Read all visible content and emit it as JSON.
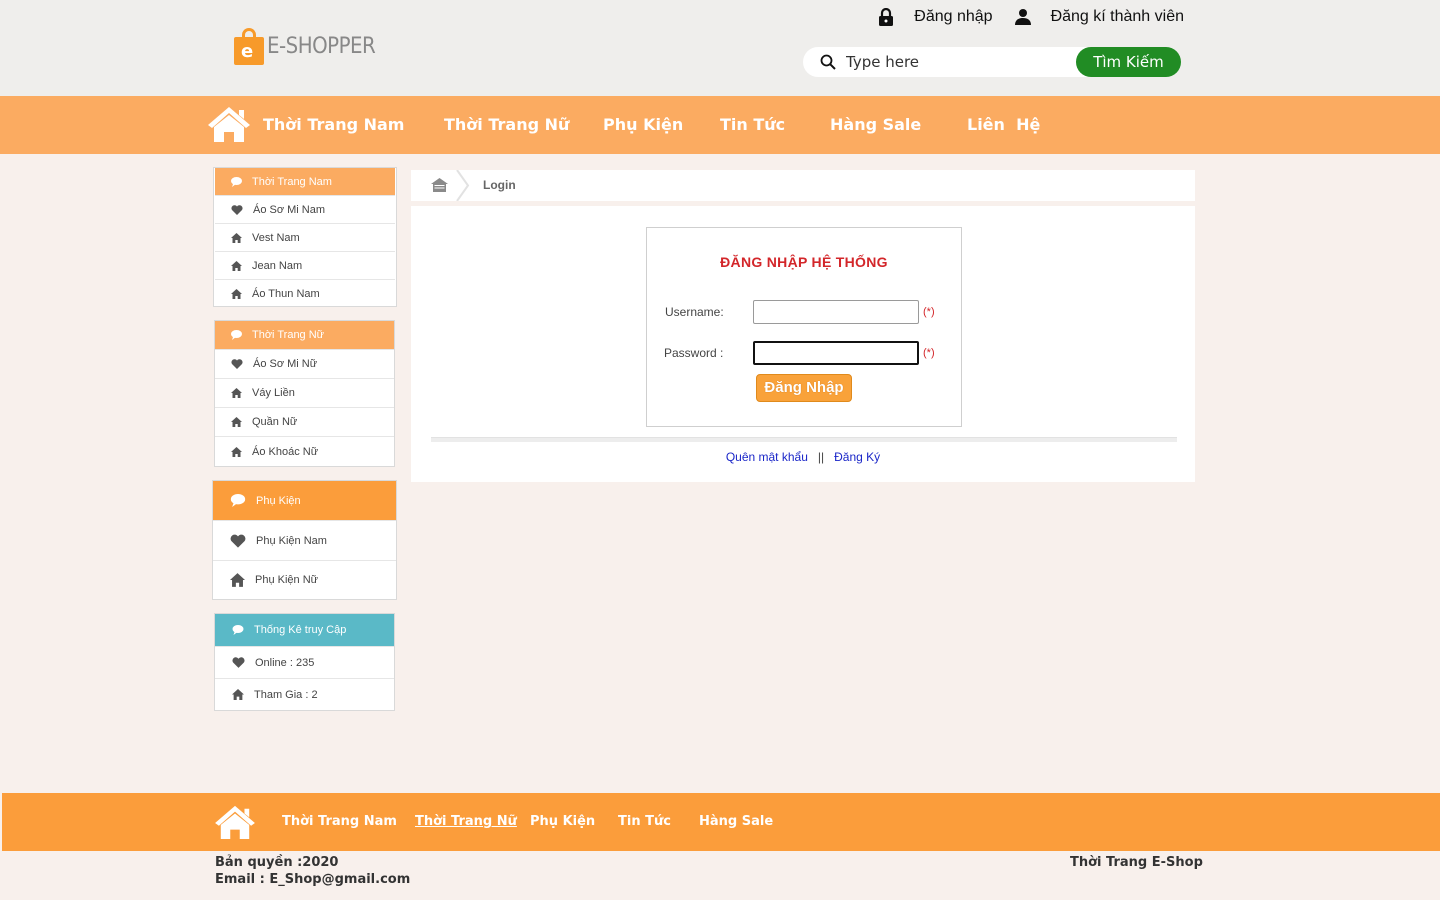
{
  "header": {
    "logo_text": "E-SHOPPER",
    "logo_letter": "e",
    "login_label": "Đăng nhập",
    "register_label": "Đăng kí thành viên",
    "search_placeholder": "Type here",
    "search_button": "Tìm Kiếm"
  },
  "nav": {
    "items": [
      "Thời Trang Nam",
      "Thời Trang Nữ",
      "Phụ Kiện",
      "Tin Tức",
      "Hàng Sale",
      "Liên  Hệ"
    ]
  },
  "sidebar": {
    "men": {
      "title": "Thời Trang Nam",
      "items": [
        "Áo Sơ Mi Nam",
        "Vest Nam",
        "Jean Nam",
        "Áo Thun Nam"
      ]
    },
    "women": {
      "title": "Thời Trang Nữ",
      "items": [
        "Áo Sơ Mi Nữ",
        "Váy Liền",
        "Quần Nữ",
        "Áo Khoác Nữ"
      ]
    },
    "accessories": {
      "title": "Phụ Kiện",
      "items": [
        "Phụ Kiện Nam",
        "Phụ Kiện Nữ"
      ]
    },
    "stats": {
      "title": "Thống Kê truy Cập",
      "items": [
        "Online : 235",
        "Tham Gia : 2"
      ]
    }
  },
  "breadcrumb": {
    "label": "Login"
  },
  "login": {
    "title": "ĐĂNG NHẬP HỆ THỐNG",
    "username_label": "Username:",
    "password_label": "Password :",
    "username_value": "",
    "password_value": "",
    "required_mark": "(*)",
    "submit_label": "Đăng Nhập",
    "forgot_link": "Quên mật khẩu",
    "link_separator": "||",
    "register_link": "Đăng Ký"
  },
  "footer": {
    "items": [
      "Thời Trang Nam",
      "Thời Trang Nữ",
      "Phụ Kiện",
      "Tin Tức",
      "Hàng Sale"
    ],
    "copyright": "Bản quyền :2020",
    "email": "Email : E_Shop@gmail.com",
    "brand": "Thời Trang E-Shop"
  },
  "colors": {
    "nav_bg": "#fbab61",
    "footer_bg": "#fb9d3b",
    "search_button": "#218c24",
    "stats_header": "#5ab9c7",
    "title_red": "#d3262a"
  }
}
